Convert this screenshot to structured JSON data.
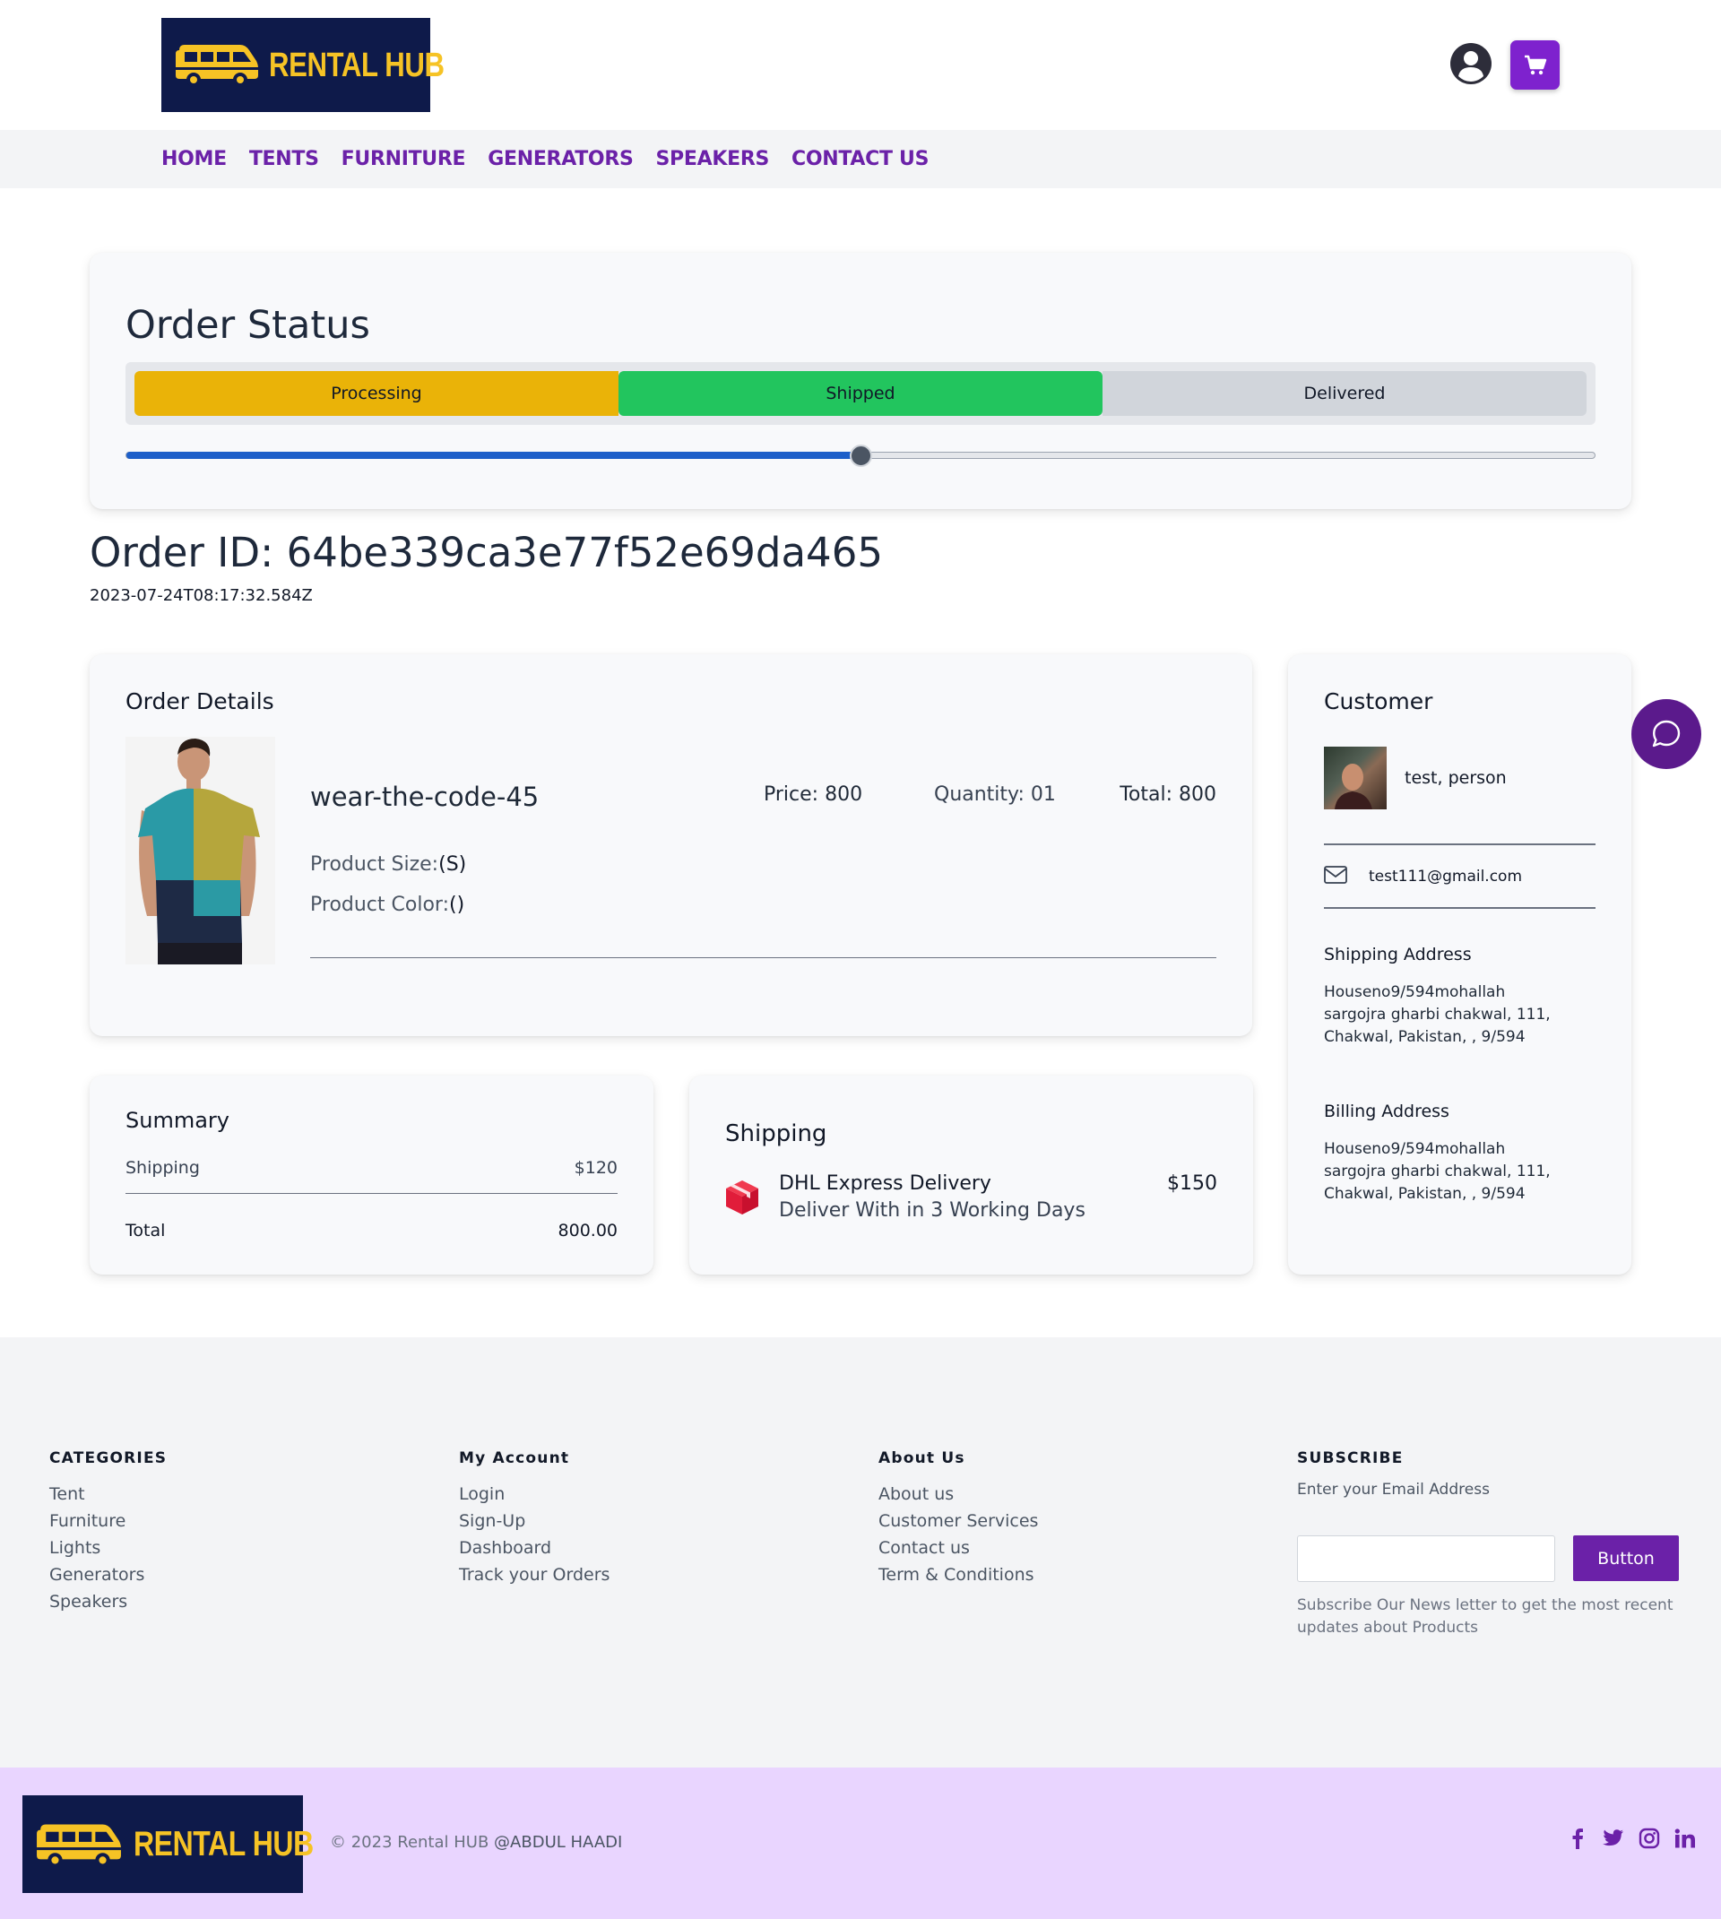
{
  "header": {
    "logo_text": "RENTAL HUB"
  },
  "nav": {
    "items": [
      "HOME",
      "TENTS",
      "FURNITURE",
      "GENERATORS",
      "SPEAKERS",
      "CONTACT US"
    ]
  },
  "order_status": {
    "title": "Order Status",
    "steps": [
      "Processing",
      "Shipped",
      "Delivered"
    ],
    "progress_fraction": 0.5
  },
  "order": {
    "id_label": "Order ID: 64be339ca3e77f52e69da465",
    "date": "2023-07-24T08:17:32.584Z"
  },
  "details": {
    "title": "Order Details",
    "product_name": "wear-the-code-45",
    "price": "Price: 800",
    "quantity": "Quantity: 01",
    "total": "Total: 800",
    "size_label": "Product Size:",
    "size_value": "(S)",
    "color_label": "Product Color:",
    "color_value": "()"
  },
  "summary": {
    "title": "Summary",
    "shipping_label": "Shipping",
    "shipping_value": "$120",
    "total_label": "Total",
    "total_value": "800.00"
  },
  "shipping": {
    "title": "Shipping",
    "carrier": "DHL Express Delivery",
    "eta": "Deliver With in 3 Working Days",
    "cost": "$150"
  },
  "customer": {
    "title": "Customer",
    "name": "test, person",
    "email": "test111@gmail.com",
    "shipping_title": "Shipping Address",
    "shipping_address": "Houseno9/594mohallah sargojra gharbi chakwal, 111, Chakwal, Pakistan, , 9/594",
    "billing_title": "Billing Address",
    "billing_address": "Houseno9/594mohallah sargojra gharbi chakwal, 111, Chakwal, Pakistan, , 9/594"
  },
  "footer": {
    "categories": {
      "title": "CATEGORIES",
      "links": [
        "Tent",
        "Furniture",
        "Lights",
        "Generators",
        "Speakers"
      ]
    },
    "account": {
      "title": "My Account",
      "links": [
        "Login",
        "Sign-Up",
        "Dashboard",
        "Track your Orders"
      ]
    },
    "about": {
      "title": "About Us",
      "links": [
        "About us",
        "Customer Services",
        "Contact us",
        "Term & Conditions"
      ]
    },
    "subscribe": {
      "title": "SUBSCRIBE",
      "label": "Enter your Email Address",
      "button": "Button",
      "note": "Subscribe Our News letter to get the most recent updates about Products"
    }
  },
  "bottom_bar": {
    "logo_text": "RENTAL HUB",
    "copyright": "© 2023 Rental HUB",
    "author": "@ABDUL HAADI",
    "socials": [
      "facebook-icon",
      "twitter-icon",
      "instagram-icon",
      "linkedin-icon"
    ]
  },
  "colors": {
    "brand_purple": "#7e22ce",
    "nav_text": "#6b21a8",
    "processing": "#eab308",
    "shipped": "#22c55e",
    "delivered": "#d1d5db",
    "progress_blue": "#1d5fc9",
    "logo_bg": "#0e1a4a",
    "logo_yellow": "#f6c325",
    "bottom_bar": "#e9d5ff"
  }
}
